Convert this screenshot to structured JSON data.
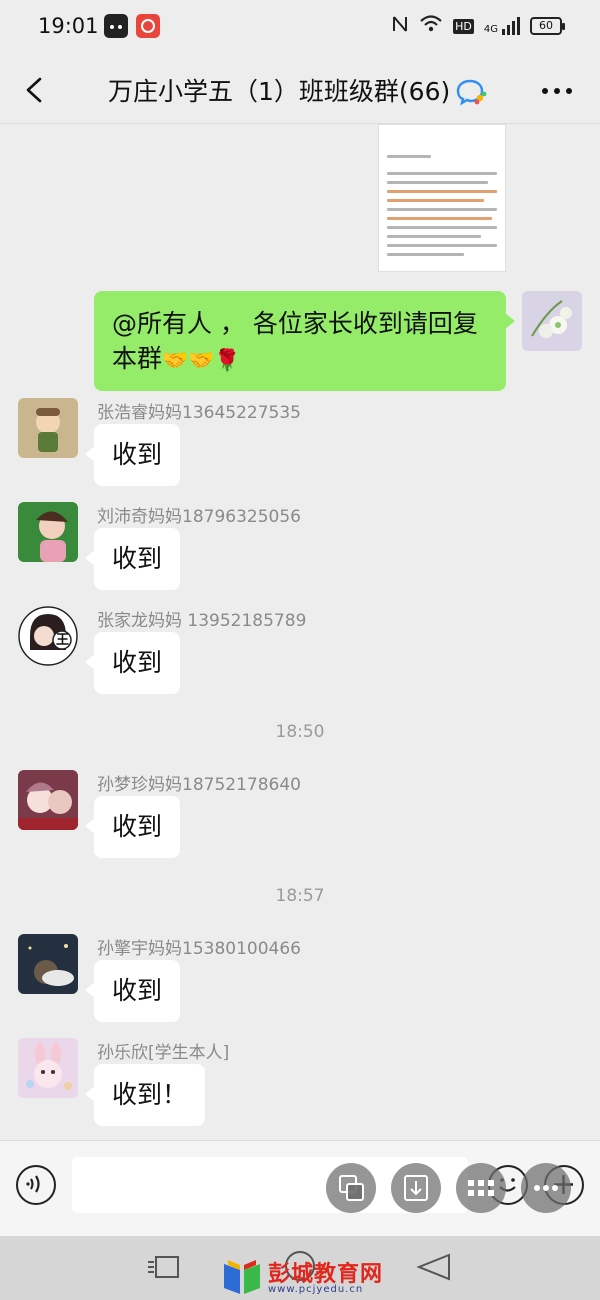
{
  "status_bar": {
    "time": "19:01",
    "network_label": "HD",
    "signal_label": "4G",
    "battery": "60",
    "icons": [
      "nfc-icon",
      "wifi-icon",
      "signal-icon",
      "battery-icon"
    ]
  },
  "header": {
    "title": "万庄小学五（1）班班级群(66)",
    "back_icon": "chevron-left-icon",
    "more_icon": "more-dots-icon",
    "badge_icon": "enterprise-group-icon"
  },
  "my_message": {
    "text": "@所有人 ， 各位家长收到请回复本群",
    "emojis": "🤝🤝🌹"
  },
  "messages": [
    {
      "sender": "张浩睿妈妈13645227535",
      "text": "收到"
    },
    {
      "sender": "刘沛奇妈妈18796325056",
      "text": "收到"
    },
    {
      "sender": "张家龙妈妈 13952185789",
      "text": "收到",
      "avatar_text": "王"
    },
    {
      "sender": "孙梦珍妈妈18752178640",
      "text": "收到"
    },
    {
      "sender": "孙擎宇妈妈15380100466",
      "text": "收到"
    },
    {
      "sender": "孙乐欣[学生本人]",
      "text": "收到！"
    }
  ],
  "timestamps": [
    "18:50",
    "18:57"
  ],
  "input_bar": {
    "voice_icon": "voice-icon",
    "emoji_icon": "emoji-icon",
    "plus_icon": "plus-icon",
    "floating_buttons": [
      "translate-icon",
      "download-icon",
      "keyboard-icon",
      "more-icon"
    ]
  },
  "watermark": {
    "title": "彭城教育网",
    "url": "www.pcjyedu.cn"
  },
  "colors": {
    "background": "#ededed",
    "my_bubble": "#95ec69",
    "other_bubble": "#ffffff",
    "sender_name": "#8a8a8a",
    "watermark_red": "#e2261c"
  }
}
